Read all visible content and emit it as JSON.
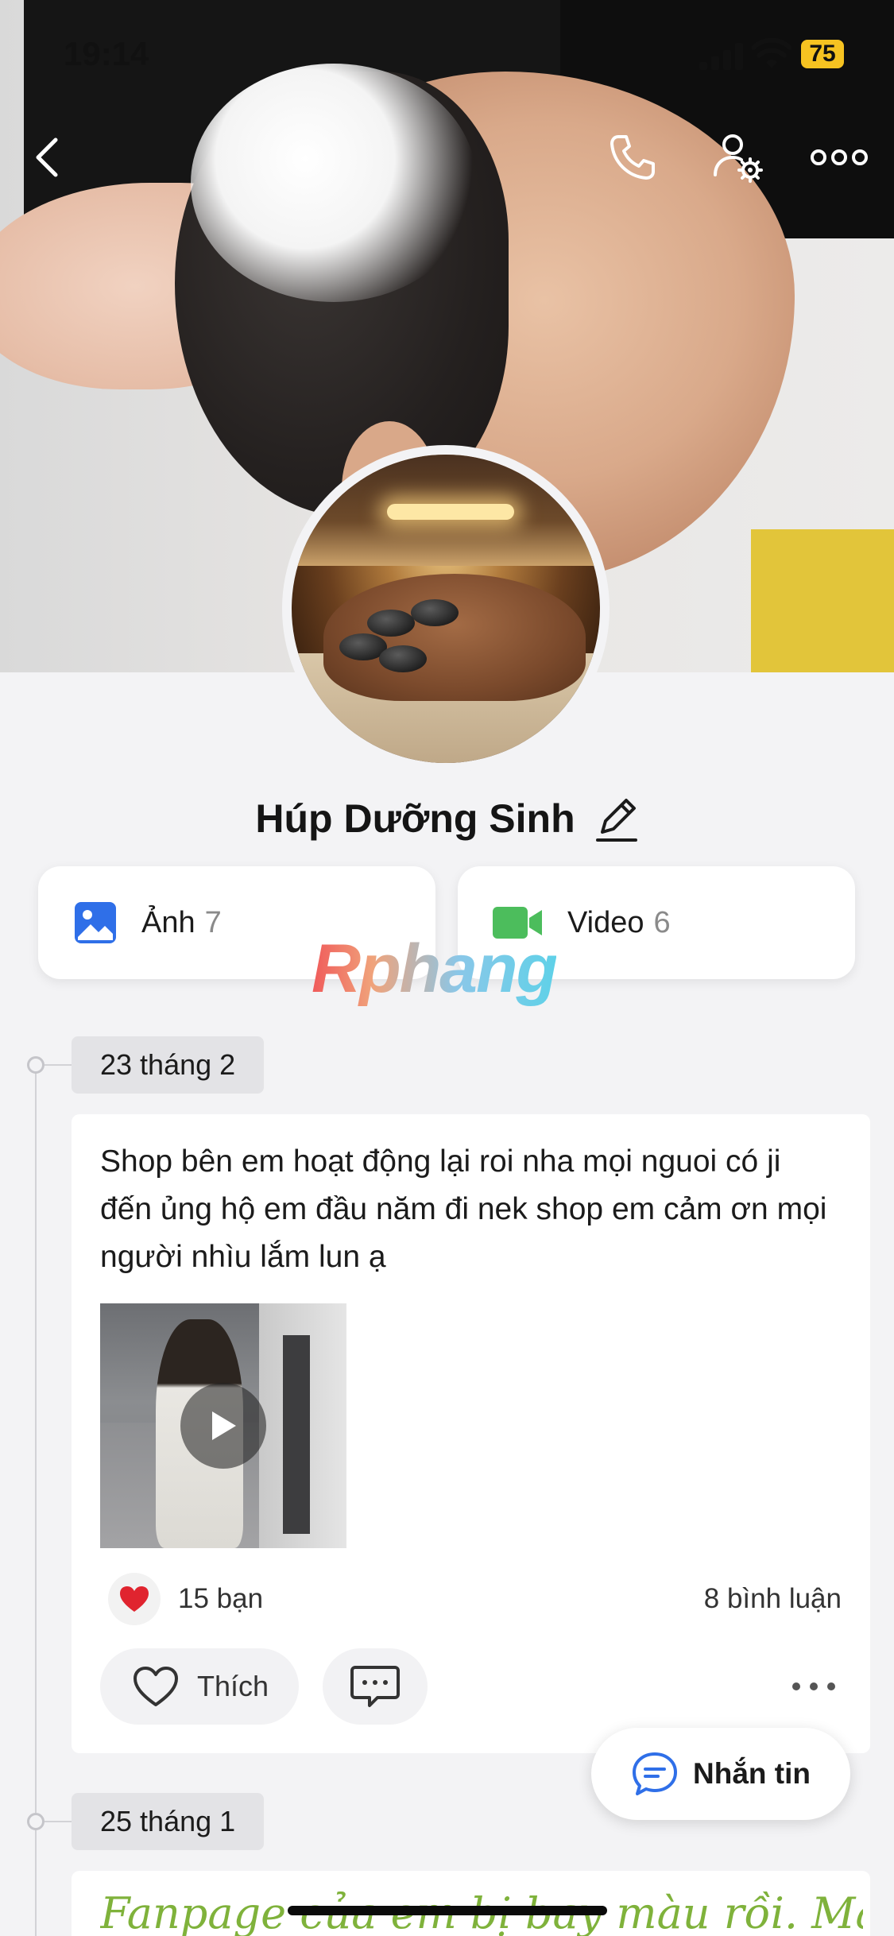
{
  "status_bar": {
    "time": "19:14",
    "battery": "75",
    "battery_color": "#f6c321"
  },
  "nav": {
    "back_icon": "chevron-left-icon",
    "call_icon": "phone-icon",
    "user_settings_icon": "user-gear-icon",
    "more_icon": "more-horizontal-icon"
  },
  "profile": {
    "name": "Húp Dưỡng Sinh",
    "edit_icon": "pencil-icon"
  },
  "media": {
    "photos": {
      "label": "Ảnh",
      "count": "7",
      "icon": "image-icon",
      "icon_color": "#2f6fe8"
    },
    "videos": {
      "label": "Video",
      "count": "6",
      "icon": "video-camera-icon",
      "icon_color": "#4cbd5c"
    }
  },
  "watermark": "Rphang",
  "timeline": [
    {
      "date": "23 tháng 2",
      "post": {
        "text": "Shop bên em hoạt động lại roi nha mọi nguoi có ji đến ủng hộ em đầu năm đi nek shop em cảm ơn mọi người nhìu lắm lun ạ",
        "reaction_icon": "heart-icon",
        "reaction_count": "15 bạn",
        "comments": "8 bình luận",
        "like_label": "Thích"
      }
    },
    {
      "date": "25 tháng 1",
      "post": {
        "text": "Fanpage của em bị bay màu rồi. Mấy anh"
      }
    }
  ],
  "message_button": {
    "label": "Nhắn tin",
    "icon": "chat-bubble-icon"
  },
  "colors": {
    "background": "#f3f3f5",
    "accent_blue": "#2f6fe8",
    "post2_text": "#7fb23b"
  }
}
